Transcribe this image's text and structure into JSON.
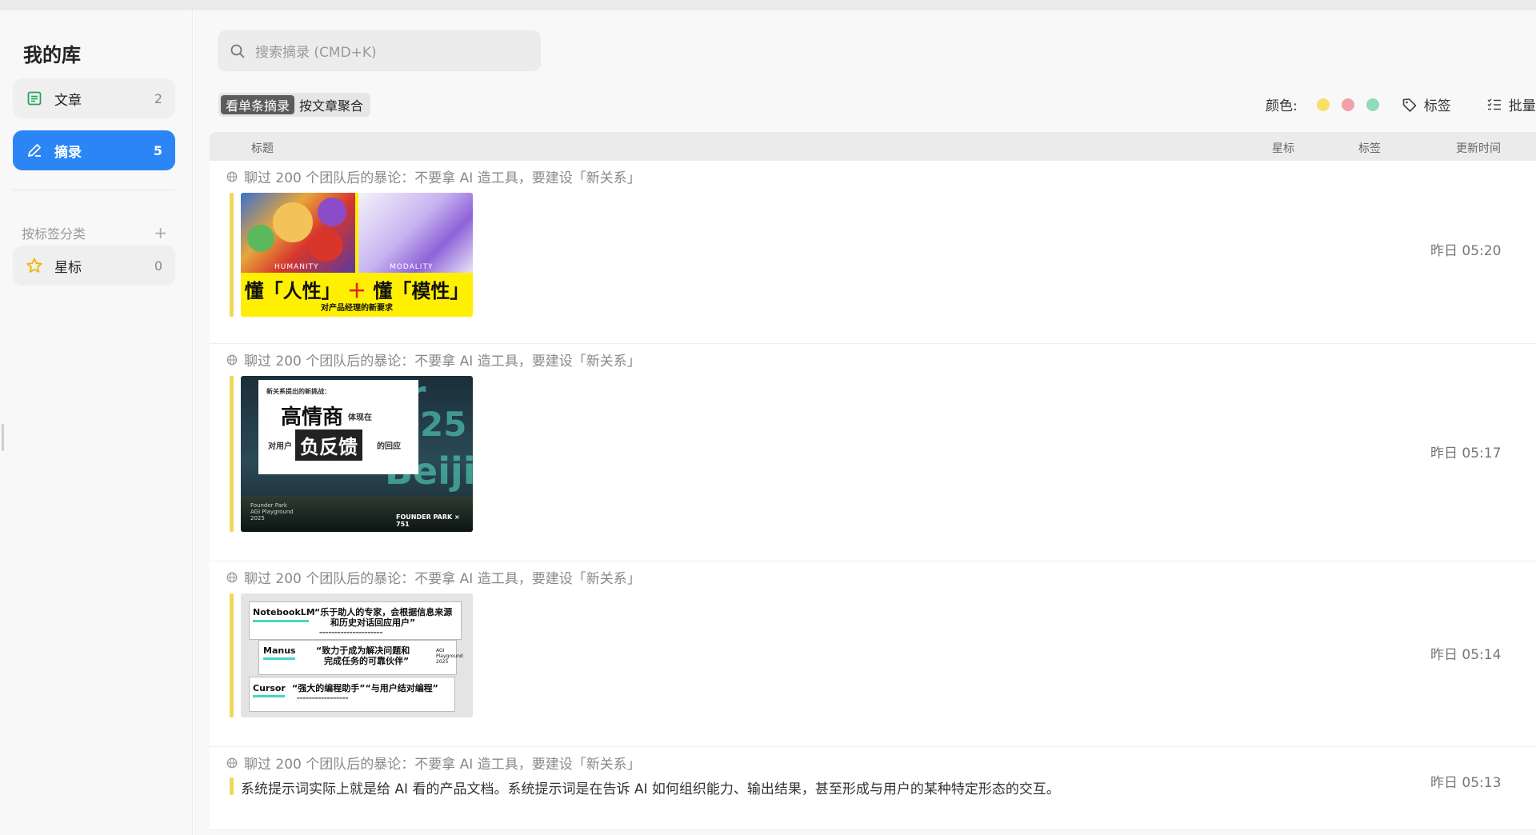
{
  "sidebar": {
    "title": "我的库",
    "items": [
      {
        "label": "文章",
        "count": "2"
      },
      {
        "label": "摘录",
        "count": "5"
      }
    ],
    "tag_section_label": "按标签分类",
    "tag_add": "+",
    "tags": [
      {
        "label": "星标",
        "count": "0"
      }
    ]
  },
  "search": {
    "placeholder": "搜索摘录 (CMD+K)"
  },
  "view_toggle": {
    "single": "看单条摘录",
    "by_article": "按文章聚合"
  },
  "filters": {
    "color_label": "颜色:",
    "colors": [
      "#f7df6a",
      "#f2a0a8",
      "#8fdcb6"
    ],
    "tag_label": "标签",
    "batch_label": "批量"
  },
  "table": {
    "columns": {
      "title": "标题",
      "star": "星标",
      "tags": "标签",
      "updated": "更新时间"
    }
  },
  "rows": [
    {
      "source": "聊过 200 个团队后的暴论：不要拿 AI 造工具，要建设「新关系」",
      "time": "昨日 05:20",
      "thumb": {
        "caption_left": "HUMANITY",
        "caption_right": "MODALITY",
        "headline_a": "懂「人性」",
        "headline_plus": "＋",
        "headline_b": "懂「模性」",
        "subline": "对产品经理的新要求"
      }
    },
    {
      "source": "聊过 200 个团队后的暴论：不要拿 AI 造工具，要建设「新关系」",
      "time": "昨日 05:17",
      "thumb": {
        "kicker": "新关系提出的新挑战：",
        "big1": "高情商",
        "side1": "体现在",
        "pre2": "对用户",
        "big2": "负反馈",
        "side2": "的回应",
        "footer_l1": "Founder Park",
        "footer_l2": "AGI Playground",
        "footer_l3": "2025",
        "logo": "FOUNDER PARK × 751"
      }
    },
    {
      "source": "聊过 200 个团队后的暴论：不要拿 AI 造工具，要建设「新关系」",
      "time": "昨日 05:14",
      "thumb": {
        "n1": "NotebookLM",
        "q1a": "“乐于助人的专家，会根据信息来源",
        "q1b": "和历史对话回应用户”",
        "n2": "Manus",
        "q2a": "“致力于成为解决问题和",
        "q2b": "完成任务的可靠伙伴”",
        "n3": "Cursor",
        "q3": "“强大的编程助手”“与用户结对编程”",
        "side": "AGI Playground 2025"
      }
    },
    {
      "source": "聊过 200 个团队后的暴论：不要拿 AI 造工具，要建设「新关系」",
      "time": "昨日 05:13",
      "snippet": "系统提示词实际上就是给 AI 看的产品文档。系统提示词是在告诉 AI 如何组织能力、输出结果，甚至形成与用户的某种特定形态的交互。"
    }
  ]
}
